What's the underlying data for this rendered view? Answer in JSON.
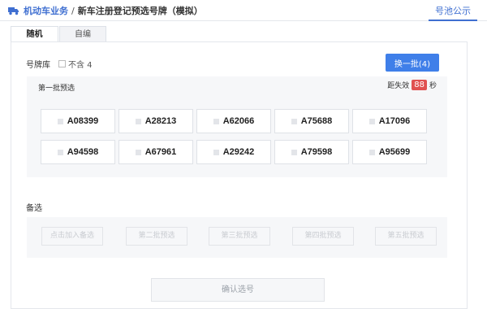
{
  "header": {
    "breadcrumb_root": "机动车业务",
    "breadcrumb_sep": "/",
    "breadcrumb_current": "新车注册登记预选号牌（模拟）",
    "notice_link": "号池公示"
  },
  "tabs": [
    {
      "label": "随机",
      "active": true
    },
    {
      "label": "自编",
      "active": false
    }
  ],
  "library": {
    "label": "号牌库",
    "option_label": "不含 4",
    "option_checked": false
  },
  "swap_button": "换一批(4)",
  "batch": {
    "title": "第一批预选",
    "timer_prefix": "距失效",
    "timer_value": "88",
    "timer_unit": "秒",
    "plates": [
      "A08399",
      "A28213",
      "A62066",
      "A75688",
      "A17096",
      "A94598",
      "A67961",
      "A29242",
      "A79598",
      "A95699"
    ]
  },
  "backup": {
    "label": "备选",
    "slots": [
      "点击加入备选",
      "第二批预选",
      "第三批预选",
      "第四批预选",
      "第五批预选"
    ]
  },
  "confirm_button": "确认选号",
  "colors": {
    "accent": "#3f7fe9",
    "link": "#3f6fd1",
    "timer_badge": "#e05151"
  }
}
